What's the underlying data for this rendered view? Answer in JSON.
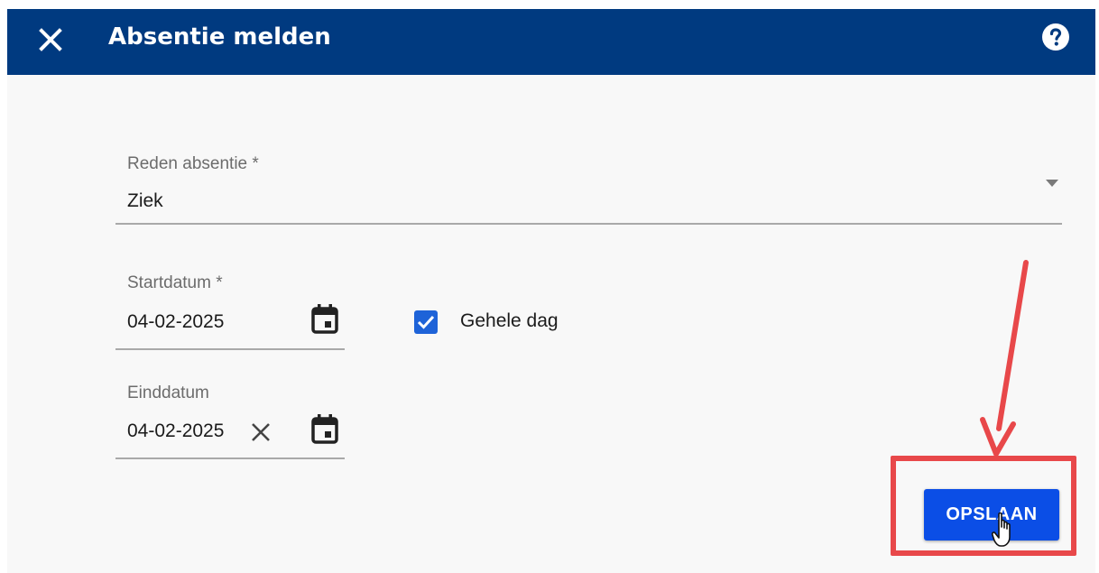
{
  "dialog": {
    "title": "Absentie melden",
    "close_icon": "close-icon",
    "help_icon": "help-icon",
    "header_color": "#003a80"
  },
  "form": {
    "reason": {
      "label": "Reden absentie *",
      "value": "Ziek",
      "icon": "dropdown-caret-icon"
    },
    "start_date": {
      "label": "Startdatum *",
      "value": "04-02-2025",
      "icon": "calendar-icon"
    },
    "whole_day": {
      "label": "Gehele dag",
      "checked": true,
      "checkbox_color": "#1e63d8"
    },
    "end_date": {
      "label": "Einddatum",
      "value": "04-02-2025",
      "clear_icon": "clear-icon",
      "icon": "calendar-icon"
    }
  },
  "actions": {
    "save_label": "OPSLAAN",
    "save_color": "#0b4ee6"
  },
  "annotation": {
    "highlight_color": "#e8484a",
    "cursor_icon": "hand-pointer-icon"
  }
}
